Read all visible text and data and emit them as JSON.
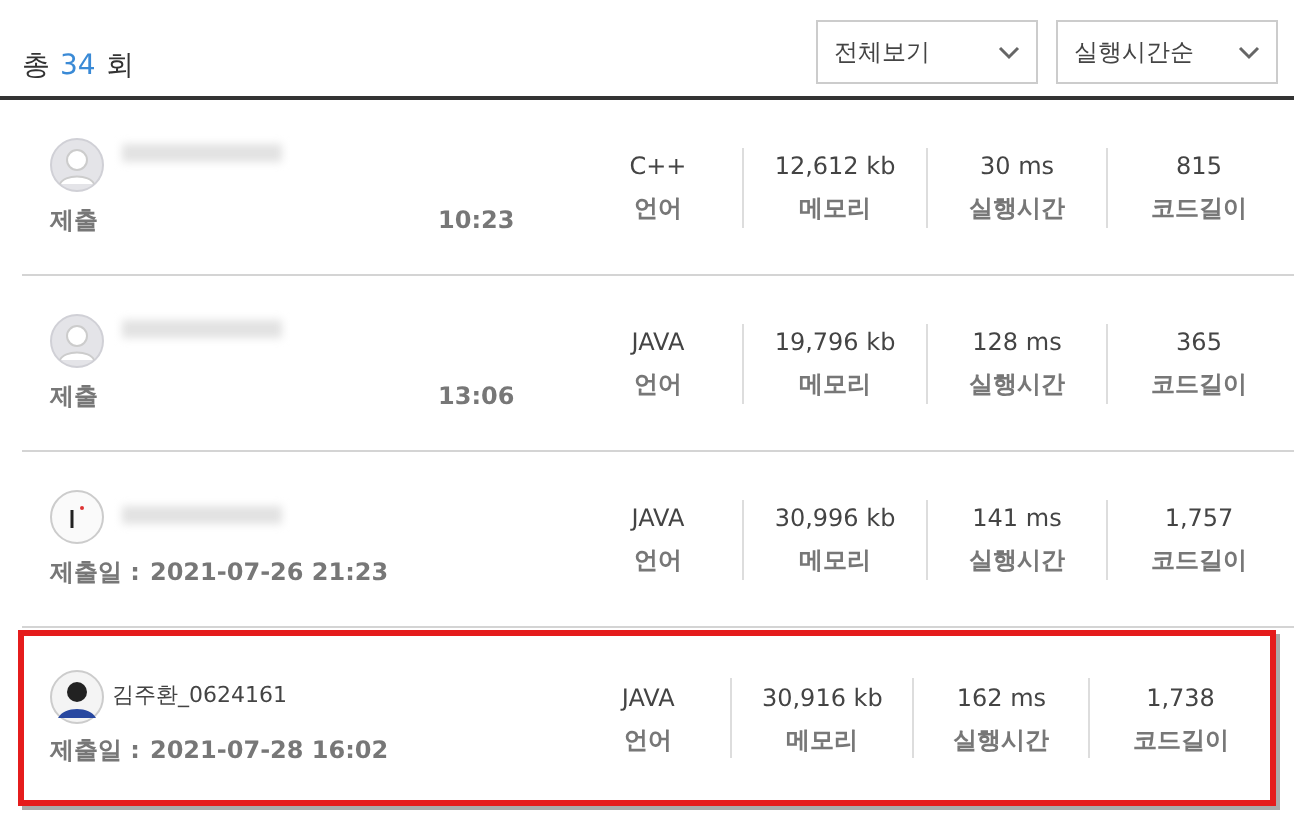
{
  "total": {
    "prefix": "총",
    "count": "34",
    "suffix": "회"
  },
  "filters": [
    {
      "label": "전체보기"
    },
    {
      "label": "실행시간순"
    }
  ],
  "submissions": [
    {
      "kind": "default",
      "redacted": true,
      "date_hidden": true,
      "selected": false,
      "date_label": "제출",
      "date": "10:23",
      "language": "C++",
      "language_label": "언어",
      "memory": "12,612 kb",
      "memory_label": "메모리",
      "time": "30 ms",
      "time_label": "실행시간",
      "code_length": "815",
      "code_length_label": "코드길이"
    },
    {
      "kind": "default",
      "redacted": true,
      "date_hidden": true,
      "selected": false,
      "date_label": "제출",
      "date": "13:06",
      "language": "JAVA",
      "language_label": "언어",
      "memory": "19,796 kb",
      "memory_label": "메모리",
      "time": "128 ms",
      "time_label": "실행시간",
      "code_length": "365",
      "code_length_label": "코드길이"
    },
    {
      "kind": "sketch",
      "redacted": true,
      "date_hidden": false,
      "selected": false,
      "date_label": "제출일 :",
      "date": "2021-07-26 21:23",
      "language": "JAVA",
      "language_label": "언어",
      "memory": "30,996 kb",
      "memory_label": "메모리",
      "time": "141 ms",
      "time_label": "실행시간",
      "code_length": "1,757",
      "code_length_label": "코드길이"
    },
    {
      "kind": "person",
      "name": "김주환_0624161",
      "redacted": false,
      "date_hidden": false,
      "selected": true,
      "date_label": "제출일 :",
      "date": "2021-07-28 16:02",
      "language": "JAVA",
      "language_label": "언어",
      "memory": "30,916 kb",
      "memory_label": "메모리",
      "time": "162 ms",
      "time_label": "실행시간",
      "code_length": "1,738",
      "code_length_label": "코드길이"
    }
  ]
}
